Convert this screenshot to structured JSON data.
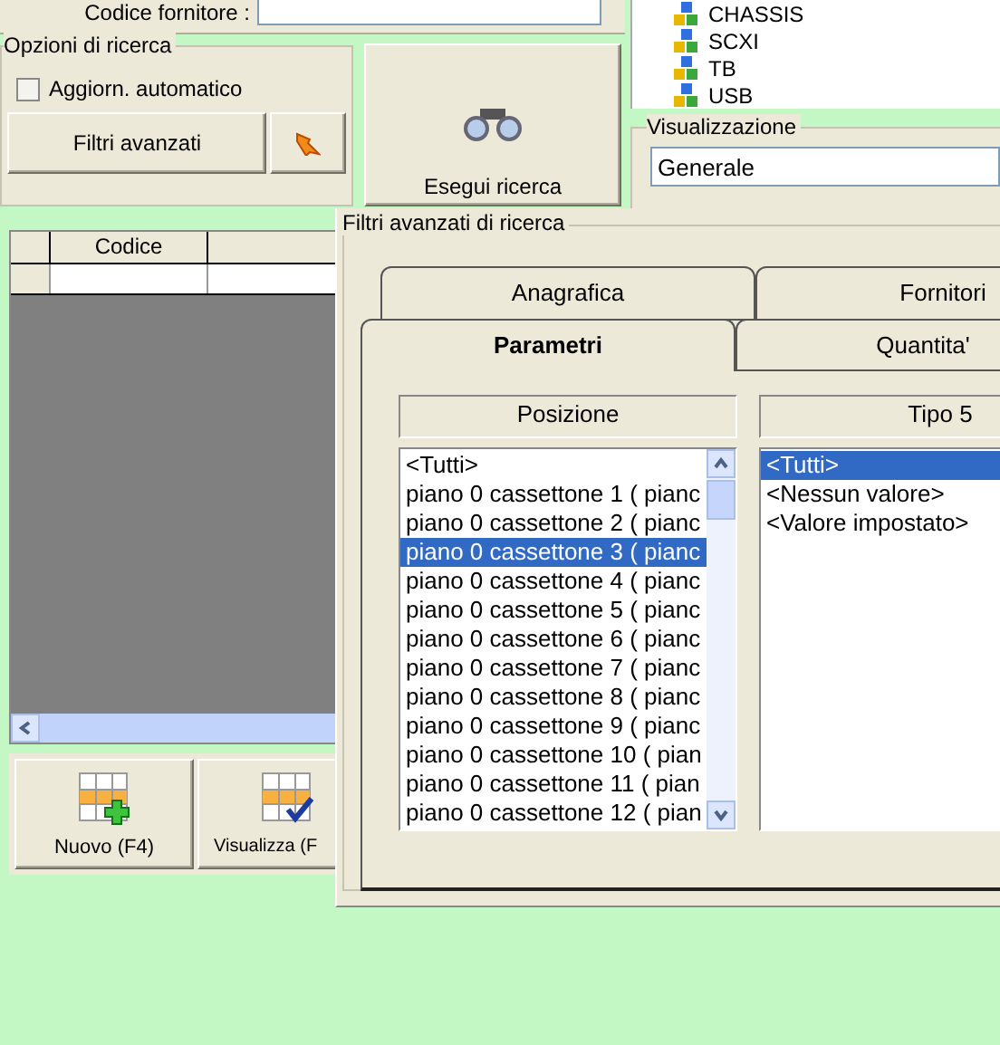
{
  "supplier_code": {
    "label": "Codice fornitore :"
  },
  "tree": {
    "items": [
      "CHASSIS",
      "SCXI",
      "TB",
      "USB"
    ]
  },
  "search_options": {
    "title": "Opzioni di ricerca",
    "auto_update": {
      "label": "Aggiorn. automatico",
      "checked": false
    },
    "advanced_button": "Filtri avanzati"
  },
  "search_button": "Esegui ricerca",
  "view": {
    "title": "Visualizzazione",
    "value": "Generale"
  },
  "grid": {
    "columns": [
      "Codice"
    ]
  },
  "actions": [
    {
      "kind": "new",
      "label": "Nuovo (F4)"
    },
    {
      "kind": "view",
      "label": "Visualizza (F"
    }
  ],
  "dialog": {
    "title": "Filtri avanzati di ricerca",
    "tabs": [
      {
        "label": "Anagrafica",
        "kind": "back",
        "selected": false
      },
      {
        "label": "Fornitori",
        "kind": "back",
        "selected": false
      },
      {
        "label": "Parametri",
        "kind": "front",
        "selected": true
      },
      {
        "label": "Quantita'",
        "kind": "front",
        "selected": false
      }
    ],
    "lists": [
      {
        "header": "Posizione",
        "scrollbar": true,
        "items": [
          {
            "text": "<Tutti>",
            "selected": false
          },
          {
            "text": "piano 0 cassettone 1 ( pianc",
            "selected": false
          },
          {
            "text": "piano 0 cassettone 2 ( pianc",
            "selected": false
          },
          {
            "text": "piano 0 cassettone 3 ( pianc",
            "selected": true
          },
          {
            "text": "piano 0 cassettone 4 ( pianc",
            "selected": false
          },
          {
            "text": "piano 0 cassettone 5 ( pianc",
            "selected": false
          },
          {
            "text": "piano 0 cassettone 6 ( pianc",
            "selected": false
          },
          {
            "text": "piano 0 cassettone 7 ( pianc",
            "selected": false
          },
          {
            "text": "piano 0 cassettone 8 ( pianc",
            "selected": false
          },
          {
            "text": "piano 0 cassettone 9 ( pianc",
            "selected": false
          },
          {
            "text": "piano 0 cassettone 10 ( pian",
            "selected": false
          },
          {
            "text": "piano 0 cassettone 11 ( pian",
            "selected": false
          },
          {
            "text": "piano 0 cassettone 12 ( pian",
            "selected": false
          }
        ]
      },
      {
        "header": "Tipo 5",
        "scrollbar": false,
        "items": [
          {
            "text": "<Tutti>",
            "selected": true
          },
          {
            "text": "<Nessun valore>",
            "selected": false
          },
          {
            "text": "<Valore impostato>",
            "selected": false
          }
        ]
      }
    ]
  }
}
